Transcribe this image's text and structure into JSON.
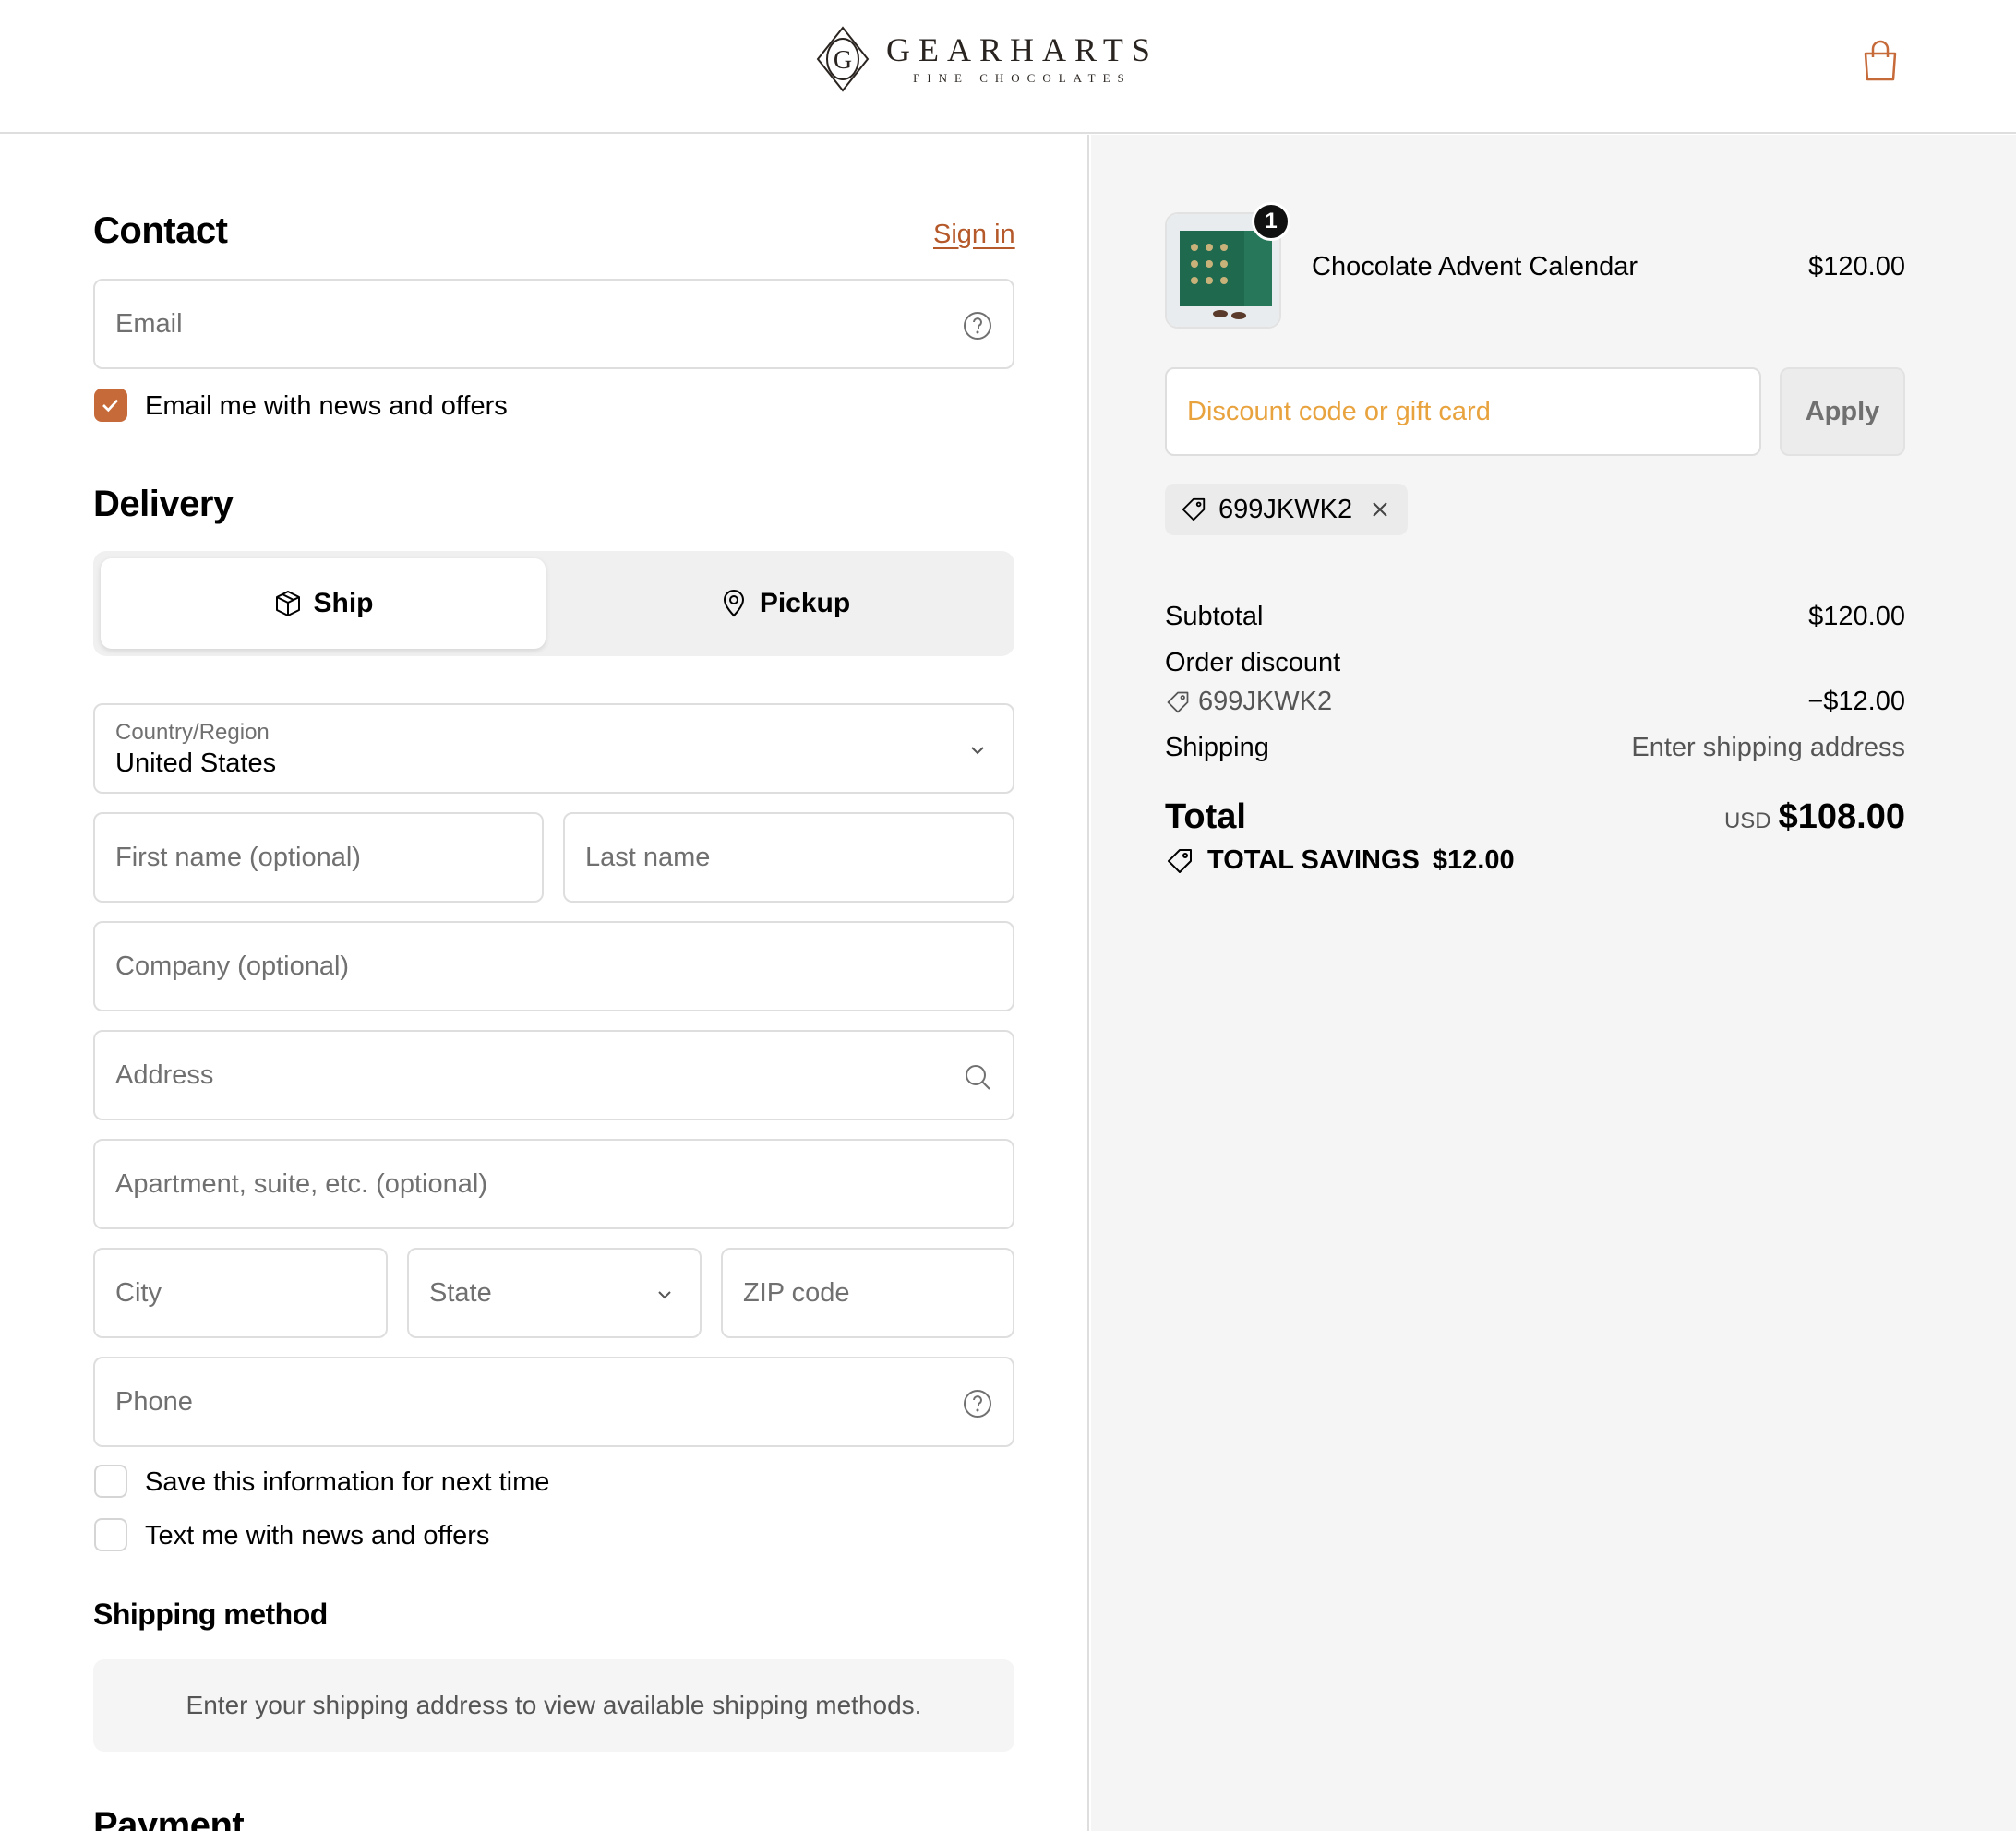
{
  "brand": {
    "name": "GEARHARTS",
    "tagline": "FINE CHOCOLATES",
    "accent": "#c66a3a"
  },
  "header": {
    "cart_icon": "shopping-bag-icon"
  },
  "contact": {
    "title": "Contact",
    "sign_in": "Sign in",
    "email_placeholder": "Email",
    "email_offers_label": "Email me with news and offers",
    "email_offers_checked": true
  },
  "delivery": {
    "title": "Delivery",
    "options": [
      {
        "label": "Ship",
        "icon": "package-icon",
        "selected": true
      },
      {
        "label": "Pickup",
        "icon": "map-pin-icon",
        "selected": false
      }
    ],
    "country_label": "Country/Region",
    "country_value": "United States",
    "first_name_placeholder": "First name (optional)",
    "last_name_placeholder": "Last name",
    "company_placeholder": "Company (optional)",
    "address_placeholder": "Address",
    "apartment_placeholder": "Apartment, suite, etc. (optional)",
    "city_placeholder": "City",
    "state_placeholder": "State",
    "zip_placeholder": "ZIP code",
    "phone_placeholder": "Phone",
    "save_info_label": "Save this information for next time",
    "text_offers_label": "Text me with news and offers"
  },
  "shipping_method": {
    "title": "Shipping method",
    "message": "Enter your shipping address to view available shipping methods."
  },
  "payment": {
    "title": "Payment"
  },
  "summary": {
    "item": {
      "name": "Chocolate Advent Calendar",
      "price": "$120.00",
      "quantity": "1"
    },
    "discount_placeholder": "Discount code or gift card",
    "apply_label": "Apply",
    "applied_code": "699JKWK2",
    "subtotal_label": "Subtotal",
    "subtotal_value": "$120.00",
    "order_discount_label": "Order discount",
    "order_discount_code": "699JKWK2",
    "order_discount_value": "−$12.00",
    "shipping_label": "Shipping",
    "shipping_value": "Enter shipping address",
    "total_label": "Total",
    "currency": "USD",
    "total_value": "$108.00",
    "savings_label": "TOTAL SAVINGS",
    "savings_value": "$12.00"
  }
}
